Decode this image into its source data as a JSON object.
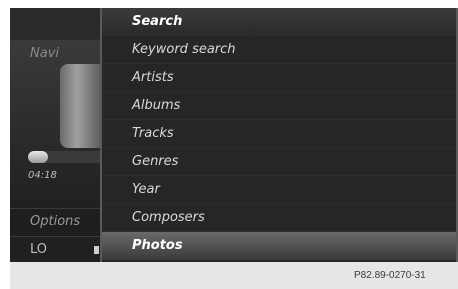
{
  "left_panel": {
    "navi_label": "Navi",
    "time": "04:18",
    "options_label": "Options",
    "lo_label": "LO",
    "progress": 0.25
  },
  "menu": {
    "header": "Search",
    "items": [
      "Keyword search",
      "Artists",
      "Albums",
      "Tracks",
      "Genres",
      "Year",
      "Composers",
      "Photos"
    ],
    "selected": "Photos"
  },
  "caption": "P82.89-0270-31"
}
